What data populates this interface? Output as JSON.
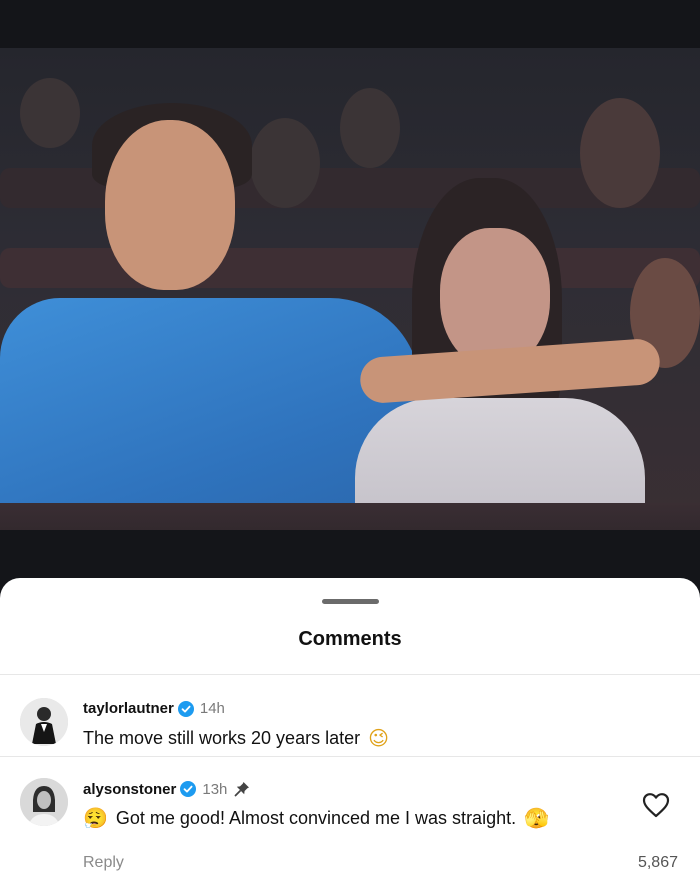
{
  "sheet": {
    "title": "Comments"
  },
  "comments": [
    {
      "username": "taylorlautner",
      "time": "14h",
      "text": "The move still works 20 years later",
      "emoji_after": "😉",
      "verified": true,
      "pinned": false
    },
    {
      "username": "alysonstoner",
      "time": "13h",
      "emoji_before": "😮‍💨",
      "text": "Got me good! Almost convinced me I was straight.",
      "emoji_after": "🫣",
      "verified": true,
      "pinned": true,
      "reply_label": "Reply",
      "like_count": "5,867"
    }
  ],
  "icons": {
    "verified": "verified-badge-icon",
    "pin": "pin-icon",
    "like": "heart-icon"
  },
  "colors": {
    "verified": "#1d9bf0",
    "sheet_bg": "#ffffff",
    "meta_text": "#7a7a7a"
  }
}
